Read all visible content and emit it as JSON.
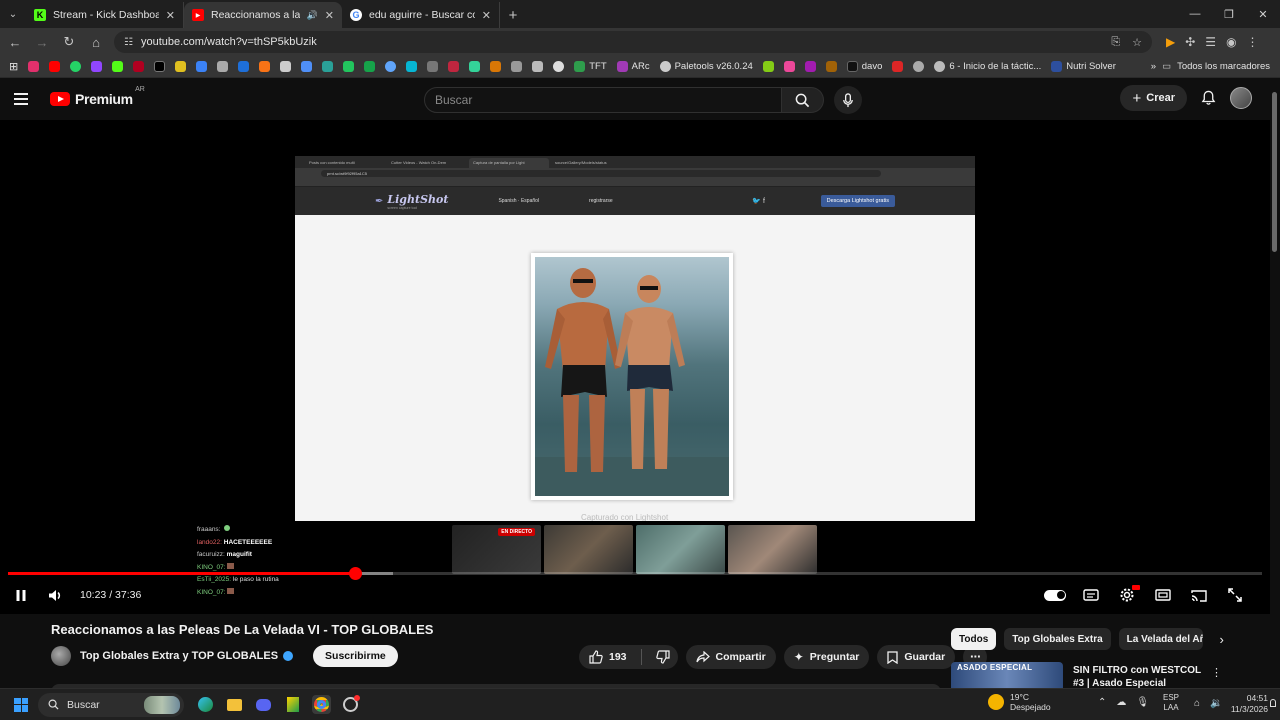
{
  "browser": {
    "tabs": [
      {
        "title": "Stream - Kick Dashboard",
        "favicon": "K",
        "color": "#53fc18",
        "active": false
      },
      {
        "title": "Reaccionamos a las Peleas D",
        "favicon": "▶",
        "color": "#ff0000",
        "active": true
      },
      {
        "title": "edu aguirre - Buscar con Google",
        "favicon": "G",
        "color": "#ffffff",
        "active": false
      }
    ],
    "url": "youtube.com/watch?v=thSP5kbUzik",
    "bookmarks": [
      {
        "label": "TFT",
        "color": "#2e9d4c"
      },
      {
        "label": "ARc",
        "color": "#a13ab5"
      },
      {
        "label": "Paletools v26.0.24",
        "color": "#cccccc"
      },
      {
        "label": "davo",
        "color": "#111111"
      },
      {
        "label": "6 - Inicio de la táctic...",
        "color": "#bbbbbb"
      },
      {
        "label": "Nutri Solver",
        "color": "#2d4f9e"
      }
    ],
    "all_bookmarks_label": "Todos los marcadores"
  },
  "youtube": {
    "logo_text": "Premium",
    "country_code": "AR",
    "search_placeholder": "Buscar",
    "create_label": "Crear"
  },
  "video_content": {
    "site_name": "LightShot",
    "site_tagline": "screen capture tool",
    "lang_selector": "Spanish · Español",
    "register_label": "registrarse",
    "download_button": "Descarga Lightshot gratis",
    "caption": "Capturado con Lightshot",
    "inner_url": "prnt.sc/wt9f92f95a1C5",
    "chat": [
      {
        "user": "fraaans:",
        "message": "",
        "user_color": "#c9c9c9"
      },
      {
        "user": "lando22:",
        "message": "HACETEEEEEE",
        "user_color": "#e06060"
      },
      {
        "user": "facuruizz:",
        "message": "maguifit",
        "user_color": "#c9c9c9"
      },
      {
        "user": "KINO_07:",
        "message": "",
        "user_color": "#7fcf7f"
      },
      {
        "user": "EsTii_2025:",
        "message": "le paso la rutina",
        "user_color": "#7fcf7f"
      },
      {
        "user": "KINO_07:",
        "message": "",
        "user_color": "#7fcf7f"
      }
    ],
    "live_badge": "EN DIRECTO"
  },
  "player": {
    "time": "10:23 / 37:36",
    "progress_fraction": 0.277,
    "buffered_fraction": 0.307
  },
  "video": {
    "title": "Reaccionamos a las Peleas De La Velada VI - TOP GLOBALES",
    "channel": "Top Globales Extra y TOP GLOBALES",
    "subscribe_label": "Suscribirme",
    "likes": "193",
    "share_label": "Compartir",
    "ask_label": "Preguntar",
    "save_label": "Guardar"
  },
  "sidebar": {
    "chips": [
      "Todos",
      "Top Globales Extra",
      "La Velada del Año"
    ],
    "rec_title": "SIN FILTRO con WESTCOL #3 | Asado Especial",
    "rec_thumb_text": "ASADO ESPECIAL"
  },
  "taskbar": {
    "search_label": "Buscar",
    "temperature": "19°C",
    "weather": "Despejado",
    "lang_top": "ESP",
    "lang_bottom": "LAA",
    "time": "04:51",
    "date": "11/3/2026"
  }
}
